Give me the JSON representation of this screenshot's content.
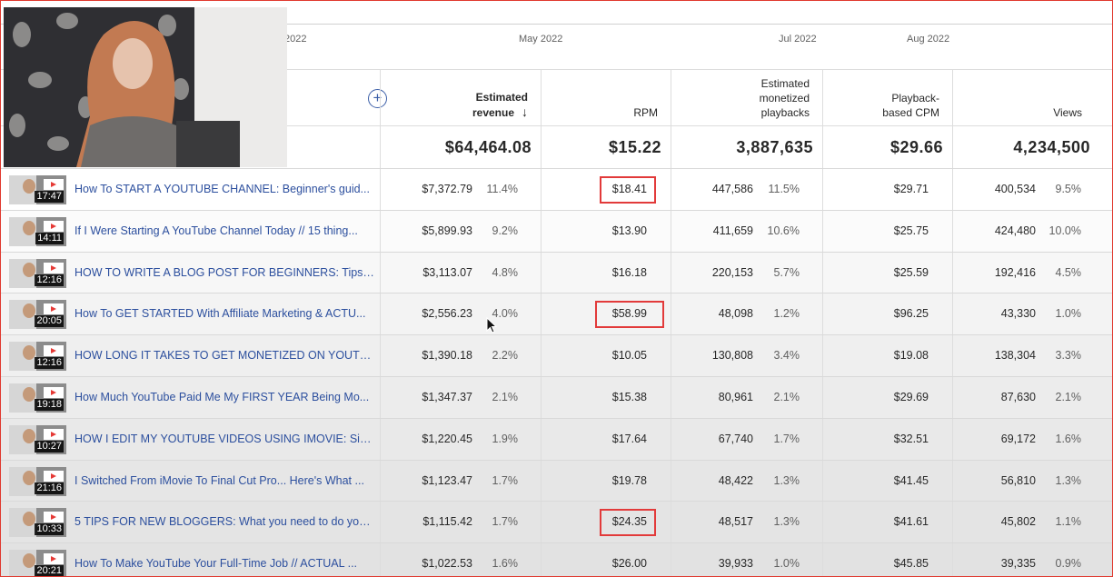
{
  "timeline": {
    "labels": [
      "2022",
      "May 2022",
      "Jul 2022",
      "Aug 2022"
    ]
  },
  "header": {
    "estimated_revenue": [
      "Estimated",
      "revenue"
    ],
    "rpm": "RPM",
    "monetized_playbacks": [
      "Estimated",
      "monetized",
      "playbacks"
    ],
    "playback_cpm": [
      "Playback-",
      "based CPM"
    ],
    "views": "Views",
    "sort_icon": "arrow-down-icon",
    "add_icon": "plus-circle-icon"
  },
  "totals": {
    "estimated_revenue": "$64,464.08",
    "rpm": "$15.22",
    "monetized_playbacks": "3,887,635",
    "playback_cpm": "$29.66",
    "views": "4,234,500"
  },
  "rows": [
    {
      "duration": "17:47",
      "title": "How To START A YOUTUBE CHANNEL: Beginner's guid...",
      "revenue": "$7,372.79",
      "revenue_pct": "11.4%",
      "rpm": "$18.41",
      "highlight": true,
      "playbacks": "447,586",
      "playbacks_pct": "11.5%",
      "cpm": "$29.71",
      "views": "400,534",
      "views_pct": "9.5%"
    },
    {
      "duration": "14:11",
      "title": "If I Were Starting A YouTube Channel Today // 15 thing...",
      "revenue": "$5,899.93",
      "revenue_pct": "9.2%",
      "rpm": "$13.90",
      "highlight": false,
      "playbacks": "411,659",
      "playbacks_pct": "10.6%",
      "cpm": "$25.75",
      "views": "424,480",
      "views_pct": "10.0%"
    },
    {
      "duration": "12:16",
      "title": "HOW TO WRITE A BLOG POST FOR BEGINNERS: Tips T...",
      "revenue": "$3,113.07",
      "revenue_pct": "4.8%",
      "rpm": "$16.18",
      "highlight": false,
      "playbacks": "220,153",
      "playbacks_pct": "5.7%",
      "cpm": "$25.59",
      "views": "192,416",
      "views_pct": "4.5%"
    },
    {
      "duration": "20:05",
      "title": "How To GET STARTED With Affiliate Marketing & ACTU...",
      "revenue": "$2,556.23",
      "revenue_pct": "4.0%",
      "rpm": "$58.99",
      "highlight": true,
      "playbacks": "48,098",
      "playbacks_pct": "1.2%",
      "cpm": "$96.25",
      "views": "43,330",
      "views_pct": "1.0%"
    },
    {
      "duration": "12:16",
      "title": "HOW LONG IT TAKES TO GET MONETIZED ON YOUTU...",
      "revenue": "$1,390.18",
      "revenue_pct": "2.2%",
      "rpm": "$10.05",
      "highlight": false,
      "playbacks": "130,808",
      "playbacks_pct": "3.4%",
      "cpm": "$19.08",
      "views": "138,304",
      "views_pct": "3.3%"
    },
    {
      "duration": "19:18",
      "title": "How Much YouTube Paid Me My FIRST YEAR Being Mo...",
      "revenue": "$1,347.37",
      "revenue_pct": "2.1%",
      "rpm": "$15.38",
      "highlight": false,
      "playbacks": "80,961",
      "playbacks_pct": "2.1%",
      "cpm": "$29.69",
      "views": "87,630",
      "views_pct": "2.1%"
    },
    {
      "duration": "10:27",
      "title": "HOW I EDIT MY YOUTUBE VIDEOS USING IMOVIE: Sim...",
      "revenue": "$1,220.45",
      "revenue_pct": "1.9%",
      "rpm": "$17.64",
      "highlight": false,
      "playbacks": "67,740",
      "playbacks_pct": "1.7%",
      "cpm": "$32.51",
      "views": "69,172",
      "views_pct": "1.6%"
    },
    {
      "duration": "21:16",
      "title": "I Switched From iMovie To Final Cut Pro... Here's What ...",
      "revenue": "$1,123.47",
      "revenue_pct": "1.7%",
      "rpm": "$19.78",
      "highlight": false,
      "playbacks": "48,422",
      "playbacks_pct": "1.3%",
      "cpm": "$41.45",
      "views": "56,810",
      "views_pct": "1.3%"
    },
    {
      "duration": "10:33",
      "title": "5 TIPS FOR NEW BLOGGERS: What you need to do your...",
      "revenue": "$1,115.42",
      "revenue_pct": "1.7%",
      "rpm": "$24.35",
      "highlight": true,
      "playbacks": "48,517",
      "playbacks_pct": "1.3%",
      "cpm": "$41.61",
      "views": "45,802",
      "views_pct": "1.1%"
    },
    {
      "duration": "20:21",
      "title": "How To Make YouTube Your Full-Time Job // ACTUAL ...",
      "revenue": "$1,022.53",
      "revenue_pct": "1.6%",
      "rpm": "$26.00",
      "highlight": false,
      "playbacks": "39,933",
      "playbacks_pct": "1.0%",
      "cpm": "$45.85",
      "views": "39,335",
      "views_pct": "0.9%"
    }
  ]
}
